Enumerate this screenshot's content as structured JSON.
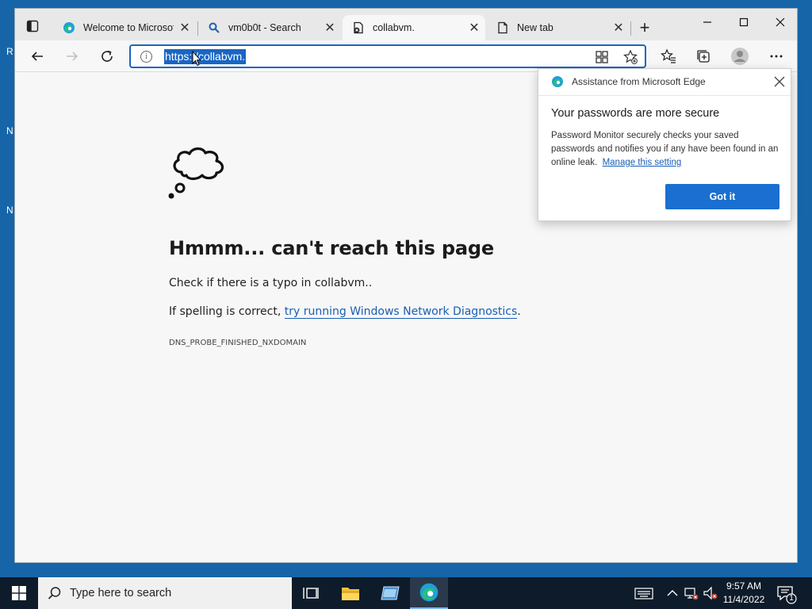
{
  "browser": {
    "tabs": [
      {
        "title": "Welcome to Microsoft",
        "close": "✕"
      },
      {
        "title": "vm0b0t - Search",
        "close": "✕"
      },
      {
        "title": "collabvm.",
        "close": "✕"
      },
      {
        "title": "New tab",
        "close": "✕"
      }
    ],
    "active_tab_index": 2,
    "new_tab_glyph": "+",
    "address_url": "https://collabvm.",
    "info_glyph": "i"
  },
  "error_page": {
    "title": "Hmmm... can't reach this page",
    "typo_line": "Check if there is a typo in collabvm..",
    "spelling_prefix": "If spelling is correct, ",
    "diagnostics_link": "try running Windows Network Diagnostics",
    "spelling_suffix": ".",
    "error_code": "DNS_PROBE_FINISHED_NXDOMAIN"
  },
  "flyout": {
    "header": "Assistance from Microsoft Edge",
    "title": "Your passwords are more secure",
    "body": "Password Monitor securely checks your saved passwords and notifies you if any have been found in an online leak.",
    "link": "Manage this setting",
    "button": "Got it"
  },
  "taskbar": {
    "search_placeholder": "Type here to search",
    "time": "9:57 AM",
    "date": "11/4/2022",
    "notification_count": "1"
  },
  "desktop": {
    "edge_letters": [
      "R",
      "N",
      "N"
    ]
  },
  "colors": {
    "accent": "#1a6fd0",
    "link": "#1a5fb4",
    "taskbar": "#0e1b2a"
  }
}
